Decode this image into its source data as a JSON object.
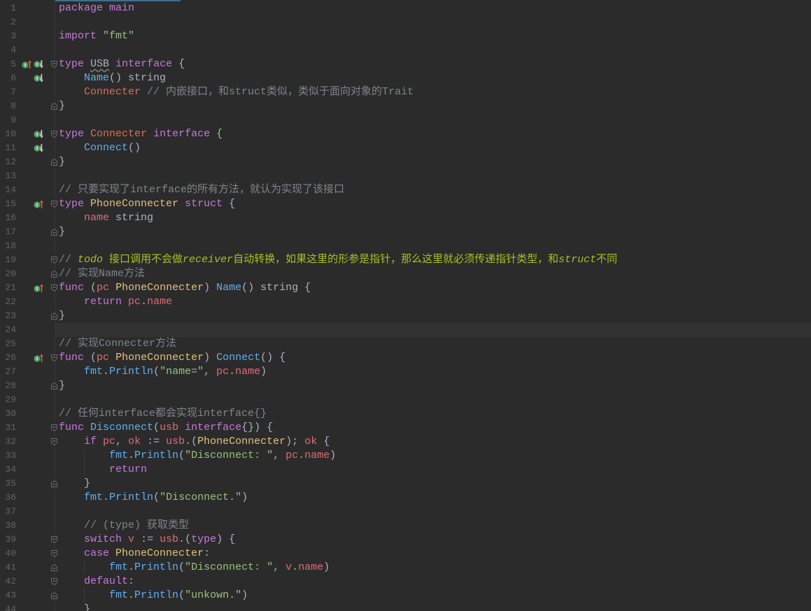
{
  "editor": {
    "caret_line": 24,
    "theme": {
      "background": "#2b2b2b",
      "caret_row": "#323232",
      "line_number": "#606366",
      "kw": "#c678dd",
      "str": "#98c379",
      "fn": "#61afef",
      "pkg": "#61afef",
      "ty": "#e5c07b",
      "ifc": "#e06c4f",
      "var": "#e06c75",
      "pln": "#abb2bf",
      "bt": "#abb2bf",
      "warn": "#abb2bf",
      "cm": "#7f848e",
      "todo": "#a8c023",
      "todoi": "#a8c023"
    },
    "lines": [
      {
        "n": 1,
        "tokens": [
          {
            "kw": "package"
          },
          {
            "pln": " "
          },
          {
            "kw": "main"
          }
        ]
      },
      {
        "n": 2,
        "tokens": []
      },
      {
        "n": 3,
        "tokens": [
          {
            "kw": "import"
          },
          {
            "pln": " "
          },
          {
            "str": "\"fmt\""
          }
        ]
      },
      {
        "n": 4,
        "tokens": []
      },
      {
        "n": 5,
        "icons": [
          "implements-icon",
          "implemented-by-icon"
        ],
        "fold": "fold-open-icon",
        "tokens": [
          {
            "kw": "type"
          },
          {
            "pln": " "
          },
          {
            "warn": "USB"
          },
          {
            "pln": " "
          },
          {
            "kw": "interface"
          },
          {
            "pln": " {"
          }
        ]
      },
      {
        "n": 6,
        "icons": [
          "implemented-by-icon"
        ],
        "tokens": [
          {
            "pln": "    "
          },
          {
            "fn": "Name"
          },
          {
            "pln": "() "
          },
          {
            "bt": "string"
          }
        ]
      },
      {
        "n": 7,
        "tokens": [
          {
            "pln": "    "
          },
          {
            "ifc": "Connecter"
          },
          {
            "pln": " "
          },
          {
            "cm": "// 内嵌接口，和struct类似，类似于面向对象的Trait"
          }
        ]
      },
      {
        "n": 8,
        "fold": "fold-close-icon",
        "tokens": [
          {
            "pln": "}"
          }
        ]
      },
      {
        "n": 9,
        "tokens": []
      },
      {
        "n": 10,
        "icons": [
          "implemented-by-icon"
        ],
        "fold": "fold-open-icon",
        "tokens": [
          {
            "kw": "type"
          },
          {
            "pln": " "
          },
          {
            "ifc": "Connecter"
          },
          {
            "pln": " "
          },
          {
            "kw": "interface"
          },
          {
            "pln": " {"
          }
        ]
      },
      {
        "n": 11,
        "icons": [
          "implemented-by-icon"
        ],
        "tokens": [
          {
            "pln": "    "
          },
          {
            "fn": "Connect"
          },
          {
            "pln": "()"
          }
        ]
      },
      {
        "n": 12,
        "fold": "fold-close-icon",
        "tokens": [
          {
            "pln": "}"
          }
        ]
      },
      {
        "n": 13,
        "tokens": []
      },
      {
        "n": 14,
        "tokens": [
          {
            "cm": "// 只要实现了interface的所有方法，就认为实现了该接口"
          }
        ]
      },
      {
        "n": 15,
        "icons": [
          "implements-icon"
        ],
        "fold": "fold-open-icon",
        "tokens": [
          {
            "kw": "type"
          },
          {
            "pln": " "
          },
          {
            "ty": "PhoneConnecter"
          },
          {
            "pln": " "
          },
          {
            "kw": "struct"
          },
          {
            "pln": " {"
          }
        ]
      },
      {
        "n": 16,
        "tokens": [
          {
            "pln": "    "
          },
          {
            "var": "name"
          },
          {
            "pln": " "
          },
          {
            "bt": "string"
          }
        ]
      },
      {
        "n": 17,
        "fold": "fold-close-icon",
        "tokens": [
          {
            "pln": "}"
          }
        ]
      },
      {
        "n": 18,
        "tokens": []
      },
      {
        "n": 19,
        "fold": "fold-open-icon",
        "tokens": [
          {
            "cm": "// "
          },
          {
            "todoi": "todo"
          },
          {
            "todo": " 接口调用不会做"
          },
          {
            "todoi": "receiver"
          },
          {
            "todo": "自动转换，如果这里的形参是指针，那么这里就必须传递指针类型，和"
          },
          {
            "todoi": "struct"
          },
          {
            "todo": "不同"
          }
        ]
      },
      {
        "n": 20,
        "fold": "fold-close-icon",
        "tokens": [
          {
            "cm": "// 实现Name方法"
          }
        ]
      },
      {
        "n": 21,
        "icons": [
          "implements-icon"
        ],
        "fold": "fold-open-icon",
        "tokens": [
          {
            "kw": "func"
          },
          {
            "pln": " ("
          },
          {
            "var": "pc"
          },
          {
            "pln": " "
          },
          {
            "ty": "PhoneConnecter"
          },
          {
            "pln": ") "
          },
          {
            "fn": "Name"
          },
          {
            "pln": "() "
          },
          {
            "bt": "string"
          },
          {
            "pln": " {"
          }
        ]
      },
      {
        "n": 22,
        "tokens": [
          {
            "pln": "    "
          },
          {
            "kw": "return"
          },
          {
            "pln": " "
          },
          {
            "var": "pc"
          },
          {
            "pln": "."
          },
          {
            "var": "name"
          }
        ]
      },
      {
        "n": 23,
        "fold": "fold-close-icon",
        "tokens": [
          {
            "pln": "}"
          }
        ]
      },
      {
        "n": 24,
        "tokens": []
      },
      {
        "n": 25,
        "tokens": [
          {
            "cm": "// 实现Connecter方法"
          }
        ]
      },
      {
        "n": 26,
        "icons": [
          "implements-icon"
        ],
        "fold": "fold-open-icon",
        "tokens": [
          {
            "kw": "func"
          },
          {
            "pln": " ("
          },
          {
            "var": "pc"
          },
          {
            "pln": " "
          },
          {
            "ty": "PhoneConnecter"
          },
          {
            "pln": ") "
          },
          {
            "fn": "Connect"
          },
          {
            "pln": "() {"
          }
        ]
      },
      {
        "n": 27,
        "tokens": [
          {
            "pln": "    "
          },
          {
            "pkg": "fmt"
          },
          {
            "pln": "."
          },
          {
            "fn": "Println"
          },
          {
            "pln": "("
          },
          {
            "str": "\"name=\""
          },
          {
            "pln": ", "
          },
          {
            "var": "pc"
          },
          {
            "pln": "."
          },
          {
            "var": "name"
          },
          {
            "pln": ")"
          }
        ]
      },
      {
        "n": 28,
        "fold": "fold-close-icon",
        "tokens": [
          {
            "pln": "}"
          }
        ]
      },
      {
        "n": 29,
        "tokens": []
      },
      {
        "n": 30,
        "tokens": [
          {
            "cm": "// 任何interface都会实现interface{}"
          }
        ]
      },
      {
        "n": 31,
        "fold": "fold-open-icon",
        "tokens": [
          {
            "kw": "func"
          },
          {
            "pln": " "
          },
          {
            "fn": "Disconnect"
          },
          {
            "pln": "("
          },
          {
            "var": "usb"
          },
          {
            "pln": " "
          },
          {
            "kw": "interface"
          },
          {
            "pln": "{}) {"
          }
        ]
      },
      {
        "n": 32,
        "fold": "fold-open-icon",
        "tokens": [
          {
            "pln": "    "
          },
          {
            "kw": "if"
          },
          {
            "pln": " "
          },
          {
            "var": "pc"
          },
          {
            "pln": ", "
          },
          {
            "var": "ok"
          },
          {
            "pln": " := "
          },
          {
            "var": "usb"
          },
          {
            "pln": ".("
          },
          {
            "ty": "PhoneConnecter"
          },
          {
            "pln": "); "
          },
          {
            "var": "ok"
          },
          {
            "pln": " {"
          }
        ]
      },
      {
        "n": 33,
        "tokens": [
          {
            "pln": "        "
          },
          {
            "pkg": "fmt"
          },
          {
            "pln": "."
          },
          {
            "fn": "Println"
          },
          {
            "pln": "("
          },
          {
            "str": "\"Disconnect: \""
          },
          {
            "pln": ", "
          },
          {
            "var": "pc"
          },
          {
            "pln": "."
          },
          {
            "var": "name"
          },
          {
            "pln": ")"
          }
        ]
      },
      {
        "n": 34,
        "tokens": [
          {
            "pln": "        "
          },
          {
            "kw": "return"
          }
        ]
      },
      {
        "n": 35,
        "fold": "fold-close-icon",
        "tokens": [
          {
            "pln": "    }"
          }
        ]
      },
      {
        "n": 36,
        "tokens": [
          {
            "pln": "    "
          },
          {
            "pkg": "fmt"
          },
          {
            "pln": "."
          },
          {
            "fn": "Println"
          },
          {
            "pln": "("
          },
          {
            "str": "\"Disconnect.\""
          },
          {
            "pln": ")"
          }
        ]
      },
      {
        "n": 37,
        "tokens": []
      },
      {
        "n": 38,
        "tokens": [
          {
            "pln": "    "
          },
          {
            "cm": "// (type) 获取类型"
          }
        ]
      },
      {
        "n": 39,
        "fold": "fold-open-icon",
        "tokens": [
          {
            "pln": "    "
          },
          {
            "kw": "switch"
          },
          {
            "pln": " "
          },
          {
            "var": "v"
          },
          {
            "pln": " := "
          },
          {
            "var": "usb"
          },
          {
            "pln": ".("
          },
          {
            "kw": "type"
          },
          {
            "pln": ") {"
          }
        ]
      },
      {
        "n": 40,
        "fold": "fold-open-icon",
        "tokens": [
          {
            "pln": "    "
          },
          {
            "kw": "case"
          },
          {
            "pln": " "
          },
          {
            "ty": "PhoneConnecter"
          },
          {
            "pln": ":"
          }
        ]
      },
      {
        "n": 41,
        "fold": "fold-close-icon",
        "tokens": [
          {
            "pln": "        "
          },
          {
            "pkg": "fmt"
          },
          {
            "pln": "."
          },
          {
            "fn": "Println"
          },
          {
            "pln": "("
          },
          {
            "str": "\"Disconnect: \""
          },
          {
            "pln": ", "
          },
          {
            "var": "v"
          },
          {
            "pln": "."
          },
          {
            "var": "name"
          },
          {
            "pln": ")"
          }
        ]
      },
      {
        "n": 42,
        "fold": "fold-open-icon",
        "tokens": [
          {
            "pln": "    "
          },
          {
            "kw": "default"
          },
          {
            "pln": ":"
          }
        ]
      },
      {
        "n": 43,
        "fold": "fold-close-icon",
        "tokens": [
          {
            "pln": "        "
          },
          {
            "pkg": "fmt"
          },
          {
            "pln": "."
          },
          {
            "fn": "Println"
          },
          {
            "pln": "("
          },
          {
            "str": "\"unkown.\""
          },
          {
            "pln": ")"
          }
        ]
      },
      {
        "n": 44,
        "tokens": [
          {
            "pln": "    }"
          }
        ]
      }
    ]
  }
}
